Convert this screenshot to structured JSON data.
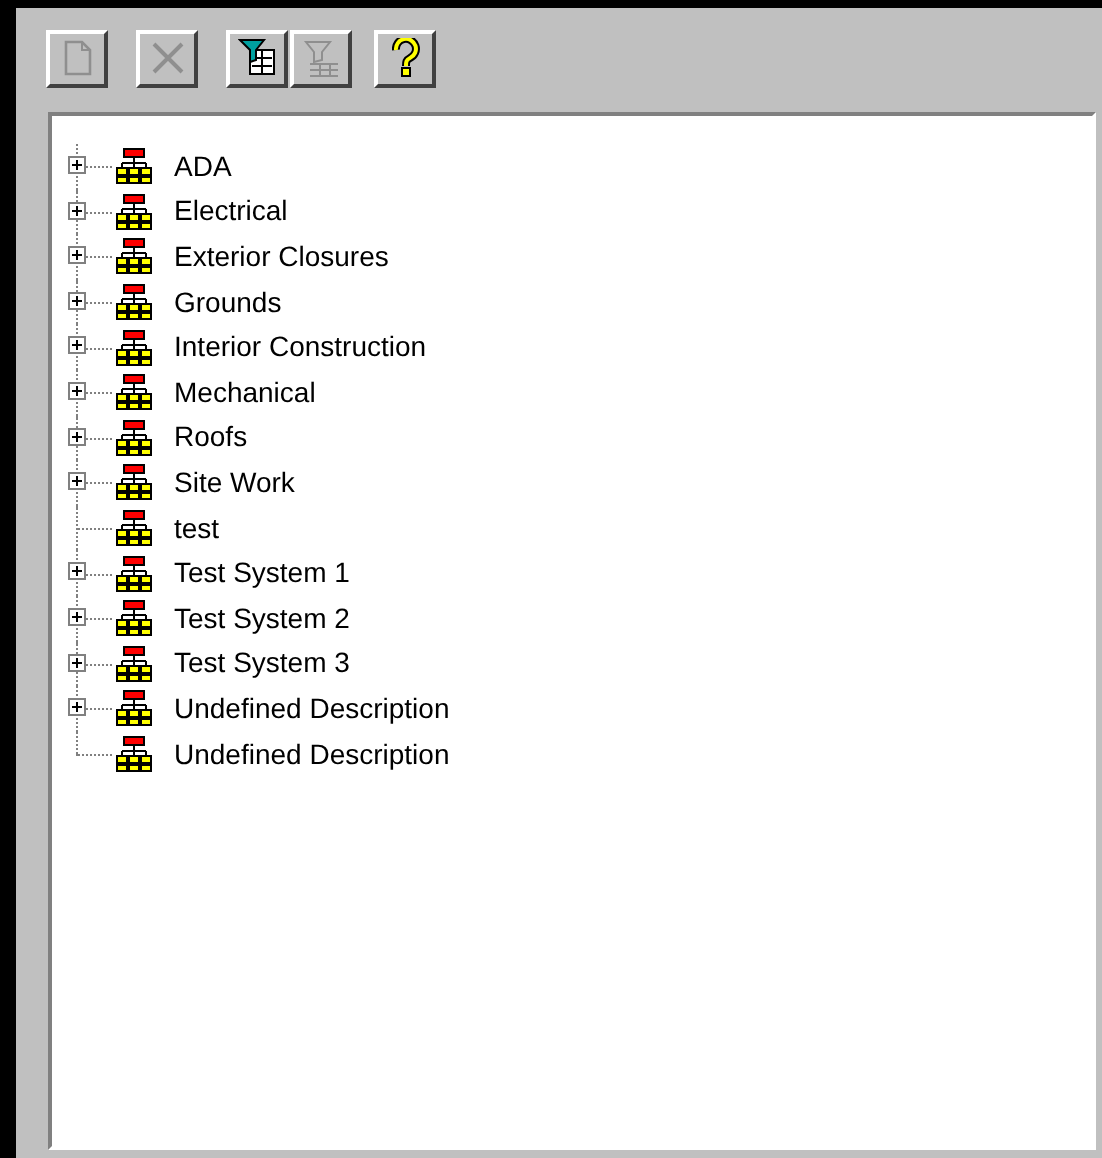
{
  "toolbar": [
    {
      "kind": "new",
      "disabled": true
    },
    {
      "kind": "delete",
      "disabled": true
    },
    {
      "kind": "filter",
      "disabled": false
    },
    {
      "kind": "clear-filter",
      "disabled": true
    },
    {
      "kind": "help",
      "disabled": false
    }
  ],
  "tree": {
    "items": [
      {
        "label": "ADA",
        "expandable": true
      },
      {
        "label": "Electrical",
        "expandable": true
      },
      {
        "label": "Exterior Closures",
        "expandable": true
      },
      {
        "label": "Grounds",
        "expandable": true
      },
      {
        "label": "Interior Construction",
        "expandable": true
      },
      {
        "label": "Mechanical",
        "expandable": true
      },
      {
        "label": "Roofs",
        "expandable": true
      },
      {
        "label": "Site Work",
        "expandable": true
      },
      {
        "label": "test",
        "expandable": false
      },
      {
        "label": "Test System 1",
        "expandable": true
      },
      {
        "label": "Test System 2",
        "expandable": true
      },
      {
        "label": "Test System 3",
        "expandable": true
      },
      {
        "label": "Undefined Description",
        "expandable": true
      },
      {
        "label": "Undefined Description",
        "expandable": false
      }
    ]
  }
}
